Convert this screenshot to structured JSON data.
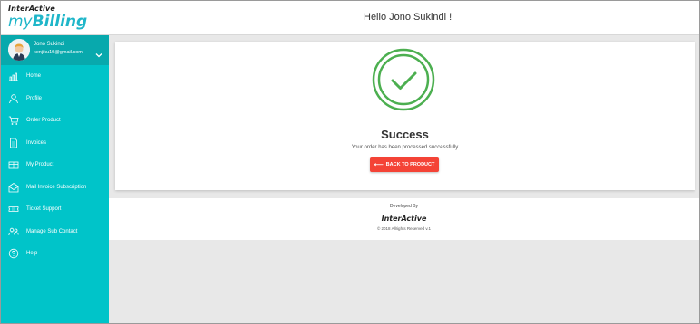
{
  "header": {
    "logo_top": "Inter",
    "logo_top_mark": "A",
    "logo_top_end": "ctive",
    "logo_my": "my",
    "logo_billing": "Billing",
    "greeting": "Hello Jono Sukindi !"
  },
  "user": {
    "name": "Jono Sukindi",
    "email": "kenjiku10@gmail.com"
  },
  "sidebar": {
    "items": [
      {
        "label": "Home",
        "icon": "chart-icon"
      },
      {
        "label": "Profile",
        "icon": "user-icon"
      },
      {
        "label": "Order Product",
        "icon": "cart-icon"
      },
      {
        "label": "Invoices",
        "icon": "document-icon"
      },
      {
        "label": "My Product",
        "icon": "box-icon"
      },
      {
        "label": "Mail Invoice Subscription",
        "icon": "mail-icon"
      },
      {
        "label": "Ticket Support",
        "icon": "ticket-icon"
      },
      {
        "label": "Manage Sub Contact",
        "icon": "contacts-icon"
      },
      {
        "label": "Help",
        "icon": "help-icon"
      }
    ]
  },
  "main": {
    "title": "Success",
    "message": "Your order has been processed successfully",
    "button_label": "BACK TO PRODUCT"
  },
  "footer": {
    "developed_by": "Developed By",
    "logo_text": "InterActive",
    "copyright": "© 2018 Allrights Reserved v.1"
  },
  "colors": {
    "sidebar": "#00c4c9",
    "sidebar_user": "#08a9ad",
    "accent": "#1fb6c9",
    "success": "#4caf50",
    "button": "#f44336"
  }
}
